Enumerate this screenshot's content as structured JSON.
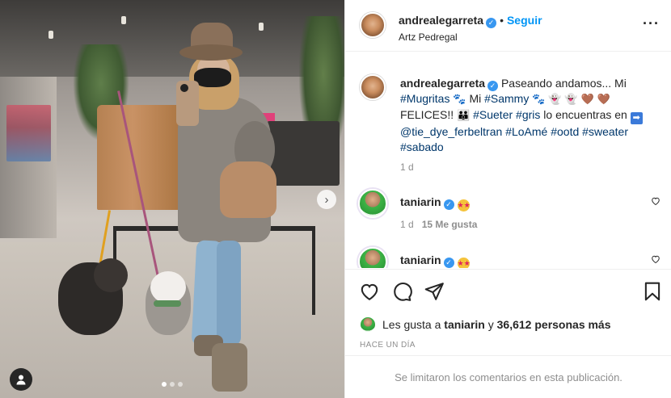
{
  "post": {
    "carousel": {
      "slide_count": 3,
      "current_slide": 1
    }
  },
  "header": {
    "username": "andrealegarreta",
    "follow_label": "Seguir",
    "location": "Artz Pedregal",
    "more_icon": "more-options-icon"
  },
  "caption": {
    "username": "andrealegarreta",
    "text_1": "Paseando andamos... Mi",
    "tag_mugritas": "#Mugritas",
    "emoji_paw": "🐾",
    "text_mi": "Mi",
    "tag_sammy": "#Sammy",
    "emoji_ghost": "👻",
    "emoji_brown_heart": "🤎",
    "text_felices": "FELICES!!",
    "emoji_family": "👪",
    "tag_sueter": "#Sueter",
    "tag_gris": "#gris",
    "text_2": "lo encuentras en",
    "emoji_arrow": "➡",
    "mention": "@tie_dye_ferbeltran",
    "tag_loame": "#LoAmé",
    "tag_ootd": "#ootd",
    "tag_sweater": "#sweater",
    "tag_sabado": "#sabado",
    "time": "1 d"
  },
  "comments": [
    {
      "username": "taniarin",
      "emoji": "🤩",
      "time": "1 d",
      "likes": "15 Me gusta"
    },
    {
      "username": "taniarin",
      "emoji": "🤩"
    }
  ],
  "likes": {
    "prefix": "Les gusta a",
    "user": "taniarin",
    "connector": "y",
    "count_text": "36,612 personas más"
  },
  "timestamp": "HACE UN DÍA",
  "comments_limited": "Se limitaron los comentarios en esta publicación.",
  "colors": {
    "link": "#00376b",
    "follow": "#0095f6",
    "verified": "#3897f0",
    "muted": "#8e8e8e"
  }
}
